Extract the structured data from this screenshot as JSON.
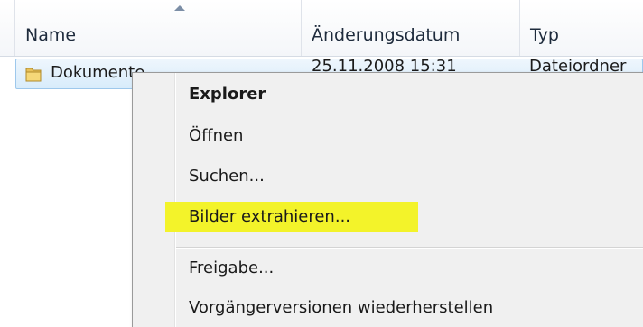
{
  "columns": {
    "name": "Name",
    "date": "Änderungsdatum",
    "type": "Typ"
  },
  "row": {
    "name": "Dokumente",
    "date": "25.11.2008 15:31",
    "type": "Dateiordner"
  },
  "context_menu": {
    "items": [
      {
        "label": "Explorer",
        "bold": true
      },
      {
        "label": "Öffnen"
      },
      {
        "label": "Suchen..."
      },
      {
        "label": "Bilder extrahieren...",
        "highlighted": true
      },
      {
        "label": "Freigabe..."
      },
      {
        "label": "Vorgängerversionen wiederherstellen"
      }
    ]
  },
  "colors": {
    "highlight": "#f3f32a",
    "selection": "#d8ecfb",
    "menu_bg": "#f0f0f0"
  }
}
